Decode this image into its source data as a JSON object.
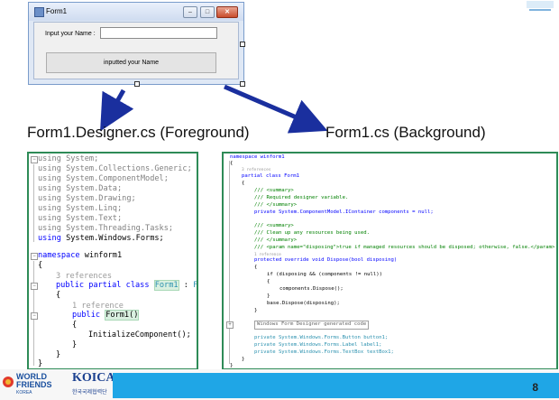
{
  "form_preview": {
    "title": "Form1",
    "label": "Input your Name :",
    "button_text": "inputted your Name",
    "min_glyph": "–",
    "max_glyph": "□",
    "close_glyph": "✕"
  },
  "headings": {
    "left": "Form1.Designer.cs (Foreground)",
    "right": "Form1.cs (Background)"
  },
  "designer_code": {
    "usings": [
      "System;",
      "System.Collections.Generic;",
      "System.ComponentModel;",
      "System.Data;",
      "System.Drawing;",
      "System.Linq;",
      "System.Text;",
      "System.Threading.Tasks;",
      "System.Windows.Forms;"
    ],
    "using_kw": "using",
    "namespace_kw": "namespace",
    "namespace_name": "winform1",
    "refs_class": "3 references",
    "public_kw": "public",
    "partial_kw": "partial",
    "class_kw": "class",
    "class_name": "Form1",
    "base_class": "Form",
    "refs_ctor": "1 reference",
    "ctor_name": "Form1()",
    "init_call": "InitializeComponent();",
    "open_brace": "{",
    "close_brace": "}"
  },
  "form_code": {
    "lines": [
      "namespace winform1",
      "{",
      "3 references",
      "partial class Form1",
      "{",
      "/// <summary>",
      "/// Required designer variable.",
      "/// </summary>",
      "private System.ComponentModel.IContainer components = null;",
      "",
      "/// <summary>",
      "/// Clean up any resources being used.",
      "/// </summary>",
      "/// <param name=\"disposing\">true if managed resources should be disposed; otherwise, false.</param>",
      "1 reference",
      "protected override void Dispose(bool disposing)",
      "{",
      "if (disposing && (components != null))",
      "{",
      "components.Dispose();",
      "}",
      "base.Dispose(disposing);",
      "}",
      "",
      "Windows Form Designer generated code",
      "",
      "private System.Windows.Forms.Button button1;",
      "private System.Windows.Forms.Label label1;",
      "private System.Windows.Forms.TextBox textBox1;",
      "}",
      "}"
    ]
  },
  "footer": {
    "logo_world": "WORLD",
    "logo_friends": "FRIENDS",
    "logo_korea": "KOREA",
    "logo_koica": "KOICA",
    "logo_koica_sub": "한국국제협력단",
    "page_number": "8"
  },
  "colors": {
    "keyword": "#0000ff",
    "type": "#2b91af",
    "comment": "#008000",
    "panel_border": "#2e8b57",
    "arrow": "#1a2f9e",
    "footer_bar": "#1fa6e6"
  }
}
